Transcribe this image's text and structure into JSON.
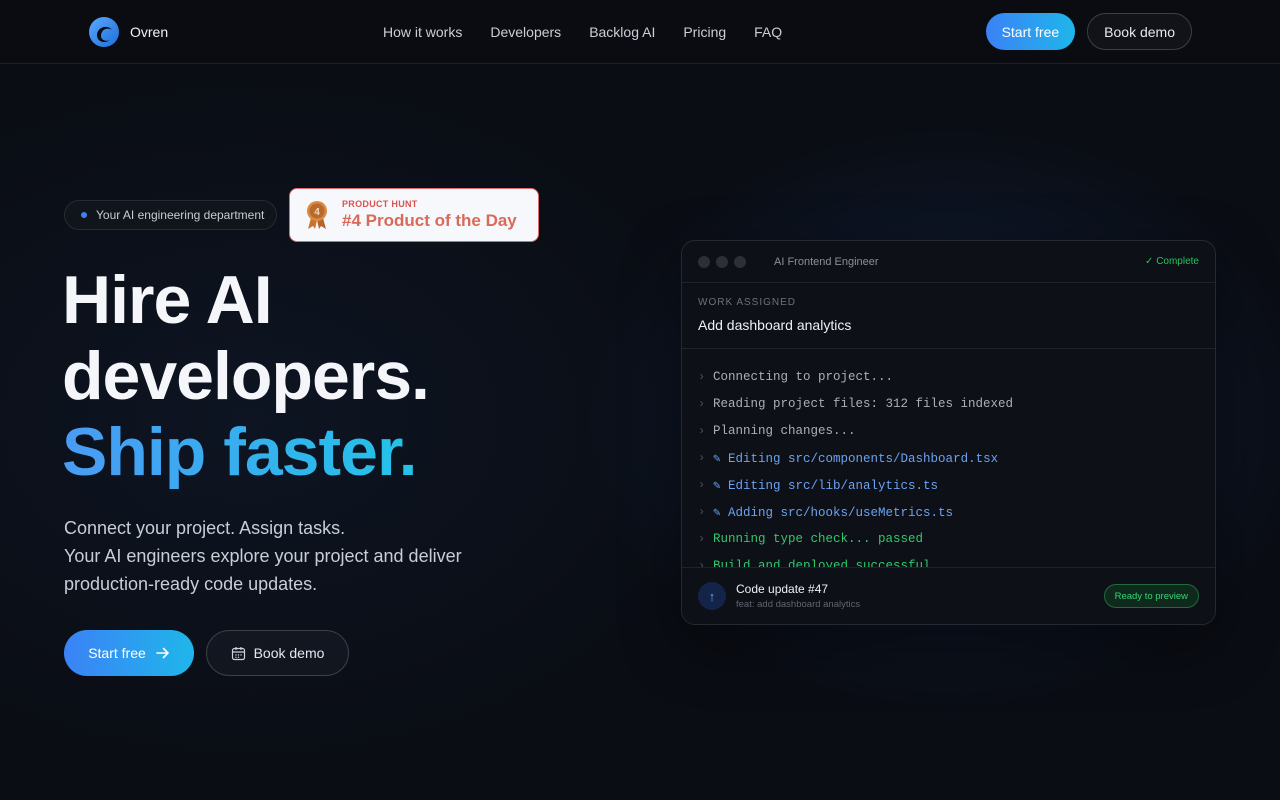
{
  "brand": {
    "name": "Ovren"
  },
  "nav": {
    "links": [
      "How it works",
      "Developers",
      "Backlog AI",
      "Pricing",
      "FAQ"
    ],
    "start_free": "Start free",
    "book_demo": "Book demo"
  },
  "hero": {
    "pill": "Your AI engineering department",
    "product_hunt": {
      "label": "PRODUCT HUNT",
      "title": "#4 Product of the Day",
      "rank": "4"
    },
    "headline": {
      "line1": "Hire AI",
      "line2": "developers.",
      "line3": "Ship faster."
    },
    "sub": {
      "line1": "Connect your project. Assign tasks.",
      "line2": "Your AI engineers explore your project and deliver",
      "line3": "production-ready code updates."
    },
    "start_free": "Start free",
    "book_demo": "Book demo"
  },
  "console": {
    "title": "AI Frontend Engineer",
    "status": "✓ Complete",
    "work_label": "WORK ASSIGNED",
    "work_title": "Add dashboard analytics",
    "log": [
      {
        "text": "Connecting to project...",
        "tone": "gray"
      },
      {
        "text": "Reading project files: 312 files indexed",
        "tone": "gray"
      },
      {
        "text": "Planning changes...",
        "tone": "gray"
      },
      {
        "text": "✎ Editing src/components/Dashboard.tsx",
        "tone": "blue"
      },
      {
        "text": "✎ Editing src/lib/analytics.ts",
        "tone": "blue"
      },
      {
        "text": "✎ Adding src/hooks/useMetrics.ts",
        "tone": "blue"
      },
      {
        "text": "Running type check... passed",
        "tone": "green"
      },
      {
        "text": "Build and deployed successful",
        "tone": "green"
      }
    ],
    "footer": {
      "title": "Code update #47",
      "subtitle": "feat: add dashboard analytics",
      "badge": "Ready to preview"
    }
  },
  "colors": {
    "accent_start": "#3b82f6",
    "accent_end": "#1fb6ea",
    "success": "#22c55e"
  }
}
